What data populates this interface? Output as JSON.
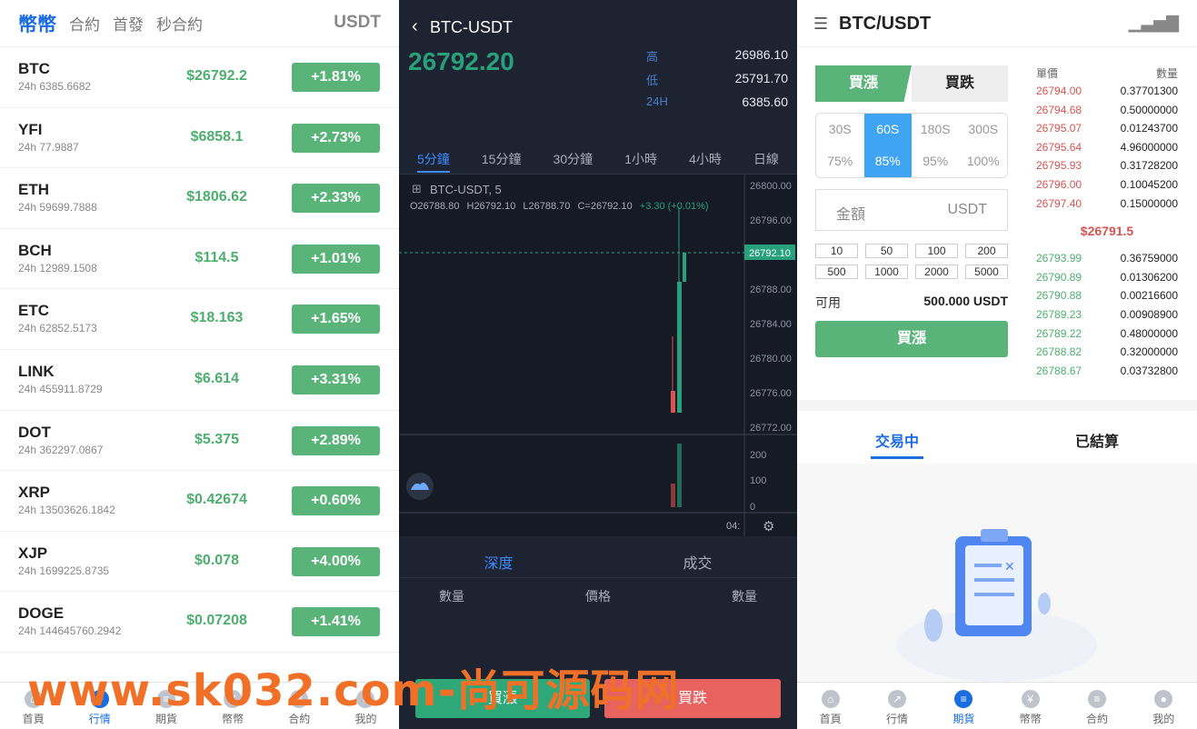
{
  "panel1": {
    "tabs": [
      "幣幣",
      "合約",
      "首發",
      "秒合約"
    ],
    "quote": "USDT",
    "markets": [
      {
        "symbol": "BTC",
        "volume": "24h 6385.6682",
        "price": "$26792.2",
        "change": "+1.81%"
      },
      {
        "symbol": "YFI",
        "volume": "24h 77.9887",
        "price": "$6858.1",
        "change": "+2.73%"
      },
      {
        "symbol": "ETH",
        "volume": "24h 59699.7888",
        "price": "$1806.62",
        "change": "+2.33%"
      },
      {
        "symbol": "BCH",
        "volume": "24h 12989.1508",
        "price": "$114.5",
        "change": "+1.01%"
      },
      {
        "symbol": "ETC",
        "volume": "24h 62852.5173",
        "price": "$18.163",
        "change": "+1.65%"
      },
      {
        "symbol": "LINK",
        "volume": "24h 455911.8729",
        "price": "$6.614",
        "change": "+3.31%"
      },
      {
        "symbol": "DOT",
        "volume": "24h 362297.0867",
        "price": "$5.375",
        "change": "+2.89%"
      },
      {
        "symbol": "XRP",
        "volume": "24h 13503626.1842",
        "price": "$0.42674",
        "change": "+0.60%"
      },
      {
        "symbol": "XJP",
        "volume": "24h 1699225.8735",
        "price": "$0.078",
        "change": "+4.00%"
      },
      {
        "symbol": "DOGE",
        "volume": "24h 144645760.2942",
        "price": "$0.07208",
        "change": "+1.41%"
      }
    ],
    "nav": [
      {
        "label": "首頁",
        "icon": "home-icon",
        "glyph": "⌂"
      },
      {
        "label": "行情",
        "icon": "market-icon",
        "glyph": "↗"
      },
      {
        "label": "期貨",
        "icon": "futures-icon",
        "glyph": "≡"
      },
      {
        "label": "幣幣",
        "icon": "coin-icon",
        "glyph": "¥"
      },
      {
        "label": "合約",
        "icon": "contract-icon",
        "glyph": "≡"
      },
      {
        "label": "我的",
        "icon": "user-icon",
        "glyph": "●"
      }
    ]
  },
  "panel2": {
    "pair": "BTC-USDT",
    "price": "26792.20",
    "stats": [
      {
        "label": "高",
        "value": "26986.10"
      },
      {
        "label": "低",
        "value": "25791.70"
      },
      {
        "label": "24H",
        "value": "6385.60"
      }
    ],
    "timeframes": [
      "5分鐘",
      "15分鐘",
      "30分鐘",
      "1小時",
      "4小時",
      "日線"
    ],
    "chart_symbol": "BTC-USDT, 5",
    "ohlc": {
      "o": "O26788.80",
      "h": "H26792.10",
      "l": "L26788.70",
      "c": "C=26792.10",
      "chg": "+3.30 (+0.01%)"
    },
    "price_ticks": [
      "26800.00",
      "26796.00",
      "26792.10",
      "26788.00",
      "26784.00",
      "26780.00",
      "26776.00",
      "26772.00"
    ],
    "volume_ticks": [
      "200",
      "100",
      "0"
    ],
    "time_label": "04:",
    "depth_tabs": [
      "深度",
      "成交"
    ],
    "depth_cols": [
      "數量",
      "價格",
      "數量"
    ],
    "buy_label": "買漲",
    "sell_label": "買跌"
  },
  "panel3": {
    "title": "BTC/USDT",
    "tab_up": "買漲",
    "tab_down": "買跌",
    "durations": [
      "30S",
      "60S",
      "180S",
      "300S"
    ],
    "rates": [
      "75%",
      "85%",
      "95%",
      "100%"
    ],
    "amount_label": "金額",
    "amount_unit": "USDT",
    "quick": [
      "10",
      "50",
      "100",
      "200",
      "500",
      "1000",
      "2000",
      "5000"
    ],
    "available_label": "可用",
    "available_value": "500.000 USDT",
    "submit": "買漲",
    "ob_headers": [
      "單價",
      "數量"
    ],
    "asks": [
      {
        "p": "26794.00",
        "q": "0.37701300"
      },
      {
        "p": "26794.68",
        "q": "0.50000000"
      },
      {
        "p": "26795.07",
        "q": "0.01243700"
      },
      {
        "p": "26795.64",
        "q": "4.96000000"
      },
      {
        "p": "26795.93",
        "q": "0.31728200"
      },
      {
        "p": "26796.00",
        "q": "0.10045200"
      },
      {
        "p": "26797.40",
        "q": "0.15000000"
      }
    ],
    "mid": "$26791.5",
    "bids": [
      {
        "p": "26793.99",
        "q": "0.36759000"
      },
      {
        "p": "26790.89",
        "q": "0.01306200"
      },
      {
        "p": "26790.88",
        "q": "0.00216600"
      },
      {
        "p": "26789.23",
        "q": "0.00908900"
      },
      {
        "p": "26789.22",
        "q": "0.48000000"
      },
      {
        "p": "26788.82",
        "q": "0.32000000"
      },
      {
        "p": "26788.67",
        "q": "0.03732800"
      }
    ],
    "order_tabs": [
      "交易中",
      "已結算"
    ],
    "nav": [
      {
        "label": "首頁",
        "glyph": "⌂"
      },
      {
        "label": "行情",
        "glyph": "↗"
      },
      {
        "label": "期貨",
        "glyph": "≡"
      },
      {
        "label": "幣幣",
        "glyph": "¥"
      },
      {
        "label": "合約",
        "glyph": "≡"
      },
      {
        "label": "我的",
        "glyph": "●"
      }
    ]
  },
  "watermark": "www.sk032.com-尚可源码网"
}
